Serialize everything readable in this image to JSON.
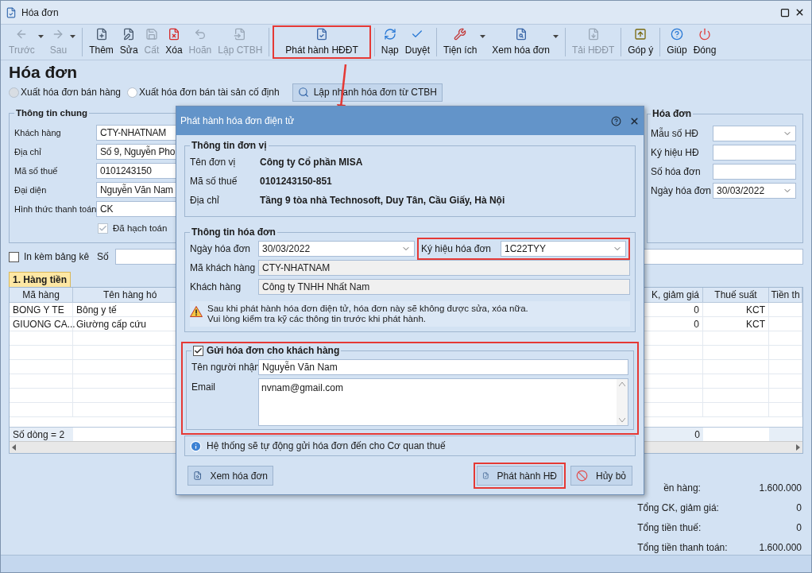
{
  "window": {
    "title": "Hóa đơn"
  },
  "toolbar": [
    [
      {
        "label": "Trước",
        "disabled": true,
        "dropdown": true,
        "highlighted": false
      },
      {
        "label": "Sau",
        "disabled": true,
        "dropdown": true,
        "highlighted": false
      }
    ],
    [
      {
        "label": "Thêm",
        "disabled": false,
        "dropdown": false,
        "highlighted": false
      },
      {
        "label": "Sửa",
        "disabled": false,
        "dropdown": false,
        "highlighted": false
      },
      {
        "label": "Cất",
        "disabled": true,
        "dropdown": false,
        "highlighted": false
      },
      {
        "label": "Xóa",
        "disabled": false,
        "dropdown": false,
        "highlighted": false
      },
      {
        "label": "Hoãn",
        "disabled": true,
        "dropdown": false,
        "highlighted": false
      },
      {
        "label": "Lập CTBH",
        "disabled": true,
        "dropdown": false,
        "highlighted": false
      }
    ],
    [
      {
        "label": "Phát hành HĐĐT",
        "disabled": false,
        "dropdown": false,
        "highlighted": true
      }
    ],
    [
      {
        "label": "Nạp",
        "disabled": false,
        "dropdown": false,
        "highlighted": false
      },
      {
        "label": "Duyệt",
        "disabled": false,
        "dropdown": false,
        "highlighted": false
      }
    ],
    [
      {
        "label": "Tiện ích",
        "disabled": false,
        "dropdown": true,
        "highlighted": false
      },
      {
        "label": "Xem hóa đơn",
        "disabled": false,
        "dropdown": true,
        "highlighted": false
      }
    ],
    [
      {
        "label": "Tải HĐĐT",
        "disabled": true,
        "dropdown": false,
        "highlighted": false
      }
    ],
    [
      {
        "label": "Góp ý",
        "disabled": false,
        "dropdown": false,
        "highlighted": false
      }
    ],
    [
      {
        "label": "Giúp",
        "disabled": false,
        "dropdown": false,
        "highlighted": false
      },
      {
        "label": "Đóng",
        "disabled": false,
        "dropdown": false,
        "highlighted": false
      }
    ]
  ],
  "page_title": "Hóa đơn",
  "invoice_types": [
    {
      "label": "Xuất hóa đơn bán hàng",
      "selected": true
    },
    {
      "label": "Xuất hóa đơn bán tài sản cố định",
      "selected": false
    }
  ],
  "quick_create_button": "Lập nhanh hóa đơn từ CTBH",
  "general_info": {
    "title": "Thông tin chung",
    "fields": [
      {
        "label": "Khách hàng",
        "value": "CTY-NHATNAM"
      },
      {
        "label": "Địa chỉ",
        "value": "Số 9, Nguyễn Pho"
      },
      {
        "label": "Mã số thuế",
        "value": "0101243150"
      },
      {
        "label": "Đại diện",
        "value": "Nguyễn Văn Nam"
      },
      {
        "label": "Hình thức thanh toán",
        "value": "CK"
      }
    ],
    "posted": {
      "label": "Đã hạch toán",
      "checked": true
    }
  },
  "invoice_info": {
    "title": "Hóa đơn",
    "fields": [
      {
        "label": "Mẫu số HĐ",
        "kind": "dropdown"
      },
      {
        "label": "Ký hiệu HĐ",
        "kind": "text"
      },
      {
        "label": "Số hóa đơn",
        "kind": "text"
      },
      {
        "label": "Ngày hóa đơn",
        "kind": "dropdown",
        "value": "30/03/2022"
      }
    ]
  },
  "attach_list": {
    "label": "In kèm bảng kê",
    "checked": false,
    "number_label": "Số"
  },
  "grid": {
    "tab": "1. Hàng tiền",
    "columns": [
      "Mã hàng",
      "Tên hàng hó",
      "K, giảm giá",
      "Thuế suất",
      "Tiền th"
    ],
    "rows": [
      {
        "cells": [
          "BONG Y TE",
          "Bông y tế",
          "0",
          "KCT"
        ]
      },
      {
        "cells": [
          "GIUONG CA...",
          "Giường cấp cứu",
          "0",
          "KCT"
        ]
      }
    ],
    "footer": {
      "count": "Số dòng = 2",
      "discount_total": "0"
    }
  },
  "totals": [
    {
      "label": "ền hàng:",
      "value": "1.600.000"
    },
    {
      "label": "Tổng CK, giảm giá:",
      "value": "0"
    },
    {
      "label": "Tổng tiền thuế:",
      "value": "0"
    },
    {
      "label": "Tổng tiền thanh toán:",
      "value": "1.600.000"
    }
  ],
  "dialog": {
    "title": "Phát hành hóa đơn điện tử",
    "unit": {
      "title": "Thông tin đơn vị",
      "rows": [
        {
          "label": "Tên đơn vị",
          "value": "Công ty Cổ phần MISA"
        },
        {
          "label": "Mã số thuế",
          "value": "0101243150-851"
        },
        {
          "label": "Địa chỉ",
          "value": "Tầng 9 tòa nhà Technosoft, Duy Tân, Cầu Giấy, Hà Nội"
        }
      ]
    },
    "invoice": {
      "title": "Thông tin hóa đơn",
      "date_label": "Ngày hóa đơn",
      "date": "30/03/2022",
      "symbol_label": "Ký hiệu hóa đơn",
      "symbol": "1C22TYY",
      "symbol_highlighted": true,
      "customer_code_label": "Mã khách hàng",
      "customer_code": "CTY-NHATNAM",
      "customer_label": "Khách hàng",
      "customer": "Công ty TNHH Nhất Nam",
      "warning": [
        "Sau khi phát hành hóa đơn điện tử, hóa đơn này sẽ không được sửa, xóa nữa.",
        "Vui lòng kiểm tra kỹ các thông tin trước khi phát hành."
      ]
    },
    "send": {
      "label": "Gửi hóa đơn cho khách hàng",
      "checked": true,
      "highlighted": true,
      "recipient_label": "Tên người nhận",
      "recipient": "Nguyễn Văn Nam",
      "email_label": "Email",
      "email": "nvnam@gmail.com"
    },
    "info": "Hệ thống sẽ tự động gửi hóa đơn đến cho Cơ quan thuế",
    "buttons": [
      {
        "label": "Xem hóa đơn",
        "highlighted": false
      },
      {
        "label": "Phát hành HĐ",
        "highlighted": true
      },
      {
        "label": "Hủy bỏ",
        "highlighted": false
      }
    ]
  }
}
